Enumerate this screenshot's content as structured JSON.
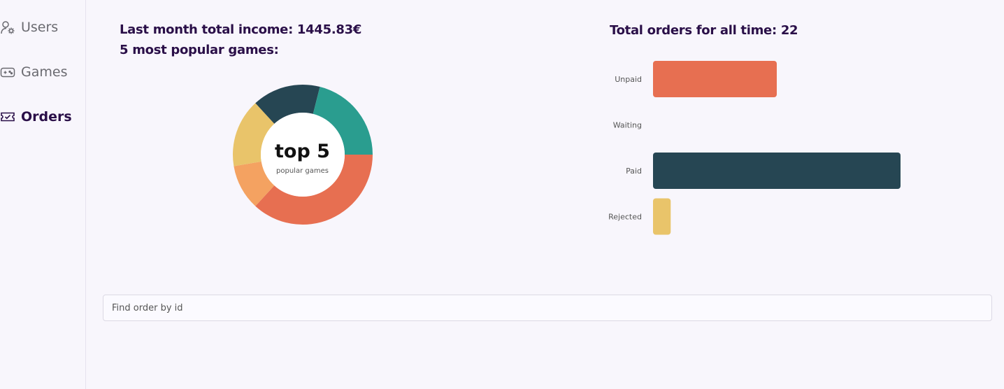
{
  "sidebar": {
    "items": [
      {
        "label": "Users",
        "icon": "user-gear-icon"
      },
      {
        "label": "Games",
        "icon": "gamepad-icon"
      },
      {
        "label": "Orders",
        "icon": "ticket-check-icon",
        "active": true
      }
    ]
  },
  "income": {
    "text": "Last month total income: 1445.83€"
  },
  "popular": {
    "heading": "5 most popular games:",
    "center_big": "top 5",
    "center_small": "popular games"
  },
  "orders": {
    "heading": "Total orders for all time: 22"
  },
  "search": {
    "placeholder": "Find order by id"
  },
  "colors": {
    "accent": "#2a0f48",
    "coral": "#e76f51",
    "orange": "#f4a261",
    "yellow": "#e9c46a",
    "dark": "#264653",
    "teal": "#2a9d8f"
  },
  "chart_data": [
    {
      "type": "pie",
      "donut": true,
      "values": [
        7,
        2,
        3,
        3,
        4
      ],
      "colors": [
        "#e76f51",
        "#f4a261",
        "#e9c46a",
        "#264653",
        "#2a9d8f"
      ]
    },
    {
      "type": "bar",
      "orientation": "horizontal",
      "categories": [
        "Unpaid",
        "Waiting",
        "Paid",
        "Rejected"
      ],
      "values": [
        7,
        0,
        14,
        1
      ],
      "colors": [
        "#e76f51",
        "#2a9d8f",
        "#264653",
        "#e9c46a"
      ],
      "xlim": [
        0,
        14
      ]
    }
  ]
}
